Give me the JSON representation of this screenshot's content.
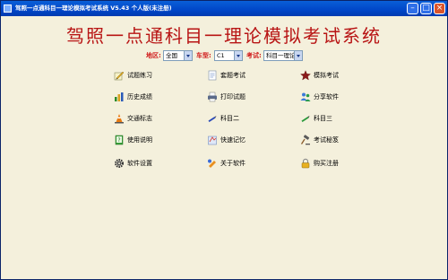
{
  "window": {
    "title": "驾照一点通科目一理论模拟考试系统 V5.43 个人版(未注册)"
  },
  "app": {
    "title": "驾照一点通科目一理论模拟考试系统"
  },
  "filters": {
    "region": {
      "label": "地区:",
      "value": "全国"
    },
    "car_type": {
      "label": "车型:",
      "value": "C1"
    },
    "exam": {
      "label": "考试:",
      "value": "科目一理论"
    }
  },
  "menu": [
    {
      "label": "试题练习",
      "icon": "pencil-paper-icon"
    },
    {
      "label": "套题考试",
      "icon": "document-icon"
    },
    {
      "label": "模拟考试",
      "icon": "star-icon"
    },
    {
      "label": "历史成绩",
      "icon": "bar-chart-icon"
    },
    {
      "label": "打印试题",
      "icon": "printer-icon"
    },
    {
      "label": "分享软件",
      "icon": "users-icon"
    },
    {
      "label": "交通标志",
      "icon": "traffic-cone-icon"
    },
    {
      "label": "科目二",
      "icon": "pen-icon"
    },
    {
      "label": "科目三",
      "icon": "marker-icon"
    },
    {
      "label": "使用说明",
      "icon": "help-book-icon"
    },
    {
      "label": "快速记忆",
      "icon": "memo-icon"
    },
    {
      "label": "考试秘笈",
      "icon": "gavel-icon"
    },
    {
      "label": "软件设置",
      "icon": "gear-icon"
    },
    {
      "label": "关于软件",
      "icon": "info-icon"
    },
    {
      "label": "购买注册",
      "icon": "lock-icon"
    }
  ],
  "colors": {
    "title_red": "#b81414",
    "label_red": "#d01818",
    "client_bg": "#f4f0dc"
  }
}
